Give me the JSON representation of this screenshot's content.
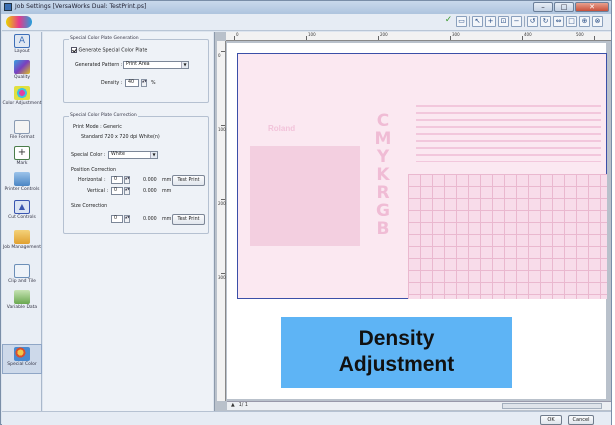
{
  "window": {
    "title": "Job Settings [VersaWorks Dual: TestPrint.ps]"
  },
  "sidebar": {
    "items": [
      {
        "label": "Layout",
        "icon": "layout-icon",
        "color": "#3d6fb8"
      },
      {
        "label": "Quality",
        "icon": "quality-icon",
        "color": "#5a3fbf"
      },
      {
        "label": "Color Adjustment",
        "icon": "color-adjustment-icon",
        "color": "#b0b0b0"
      },
      {
        "label": "File Format",
        "icon": "file-format-icon",
        "color": "#8a9bb3"
      },
      {
        "label": "Mark",
        "icon": "mark-icon",
        "color": "#4a7d4a"
      },
      {
        "label": "Printer Controls",
        "icon": "printer-controls-icon",
        "color": "#4b86c4"
      },
      {
        "label": "Cut Controls",
        "icon": "cut-controls-icon",
        "color": "#3a56b0"
      },
      {
        "label": "Job Management",
        "icon": "job-management-icon",
        "color": "#e0a030"
      },
      {
        "label": "Clip and Tile",
        "icon": "clip-and-tile-icon",
        "color": "#6c8fb8"
      },
      {
        "label": "Variable Data",
        "icon": "variable-data-icon",
        "color": "#6aa84f"
      },
      {
        "label": "Special Color",
        "icon": "special-color-icon",
        "color": "#9aa4b2"
      }
    ]
  },
  "plate_generation": {
    "title": "Special Color Plate Generation",
    "generate_label": "Generate Special Color Plate",
    "pattern_label": "Generated Pattern :",
    "pattern_value": "Print Area",
    "density_label": "Density :",
    "density_value": "40",
    "density_unit": "%"
  },
  "plate_correction": {
    "title": "Special Color Plate Correction",
    "print_mode_label": "Print Mode : Generic",
    "print_mode_value": "Standard 720 x 720 dpi White(n)",
    "special_color_label": "Special Color :",
    "special_color_value": "White",
    "position_title": "Position Correction",
    "horizontal_label": "Horizontal :",
    "horizontal_value": "0",
    "horizontal_mm": "0.000",
    "vertical_label": "Vertical :",
    "vertical_value": "0",
    "vertical_mm": "0.000",
    "mm_unit": "mm",
    "size_title": "Size Correction",
    "size_value": "0",
    "size_mm": "0.000",
    "test_print_label": "Test Print"
  },
  "ruler": {
    "h_labels": [
      "0",
      "100",
      "200",
      "300",
      "400",
      "500"
    ],
    "v_labels": [
      "0",
      "100",
      "200",
      "300"
    ]
  },
  "preview": {
    "brand_text": "Roland",
    "cmyk_text": "CMYKRGB"
  },
  "callout": {
    "line1": "Density",
    "line2": "Adjustment"
  },
  "page_nav": {
    "text": "1/ 1"
  },
  "footer": {
    "ok_label": "OK",
    "cancel_label": "Cancel"
  }
}
